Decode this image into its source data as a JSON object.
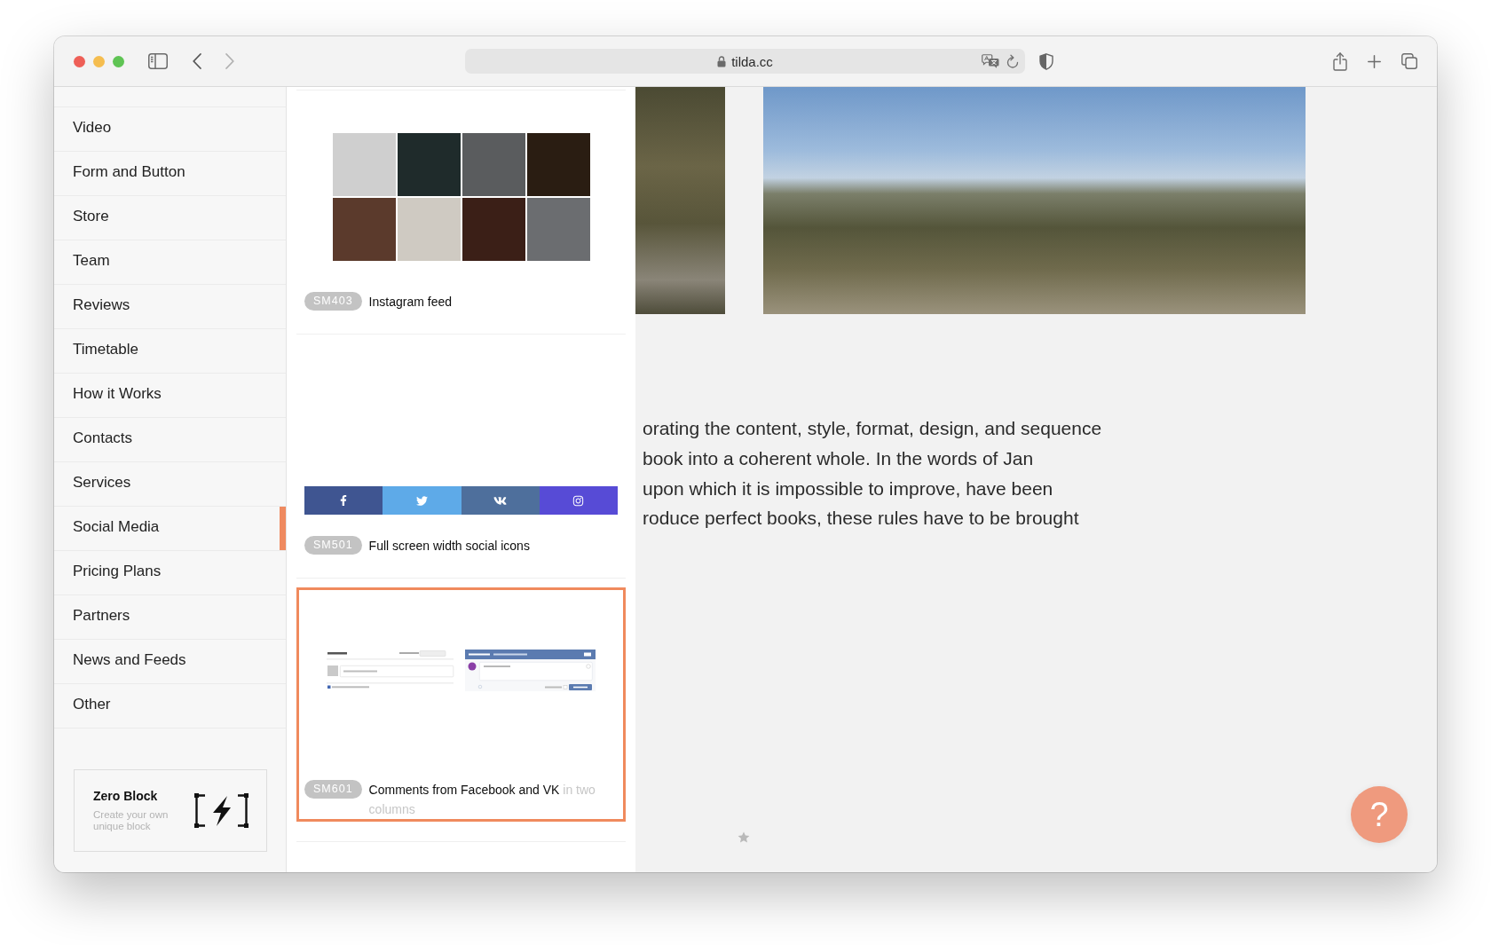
{
  "browser": {
    "url": "tilda.cc"
  },
  "sidebar": {
    "items": [
      {
        "label": "Video",
        "selected": false
      },
      {
        "label": "Form and Button",
        "selected": false
      },
      {
        "label": "Store",
        "selected": false
      },
      {
        "label": "Team",
        "selected": false
      },
      {
        "label": "Reviews",
        "selected": false
      },
      {
        "label": "Timetable",
        "selected": false
      },
      {
        "label": "How it Works",
        "selected": false
      },
      {
        "label": "Contacts",
        "selected": false
      },
      {
        "label": "Services",
        "selected": false
      },
      {
        "label": "Social Media",
        "selected": true
      },
      {
        "label": "Pricing Plans",
        "selected": false
      },
      {
        "label": "Partners",
        "selected": false
      },
      {
        "label": "News and Feeds",
        "selected": false
      },
      {
        "label": "Other",
        "selected": false
      }
    ],
    "zero_block": {
      "title": "Zero Block",
      "subtitle": "Create your own unique block"
    }
  },
  "blocks": [
    {
      "kind": "instagram",
      "code": "SM403",
      "title": "Instagram feed",
      "selected": false
    },
    {
      "kind": "social",
      "code": "SM501",
      "title": "Full screen width social icons",
      "selected": false,
      "segments": [
        {
          "kind": "facebook",
          "color": "#3f5591"
        },
        {
          "kind": "twitter",
          "color": "#5eaae8"
        },
        {
          "kind": "vk",
          "color": "#4e6f9c"
        },
        {
          "kind": "instagram",
          "color": "#574bd6"
        }
      ]
    },
    {
      "kind": "comments",
      "code": "SM601",
      "title": "Comments from Facebook and VK",
      "description": "in two columns",
      "selected": true
    }
  ],
  "page": {
    "text_lines": [
      "orating the content, style, format, design, and sequence",
      "book into a coherent whole. In the words of Jan",
      "upon which it is impossible to improve, have been",
      "roduce perfect books, these rules have to be brought"
    ],
    "help_button": {
      "label": "?"
    }
  }
}
